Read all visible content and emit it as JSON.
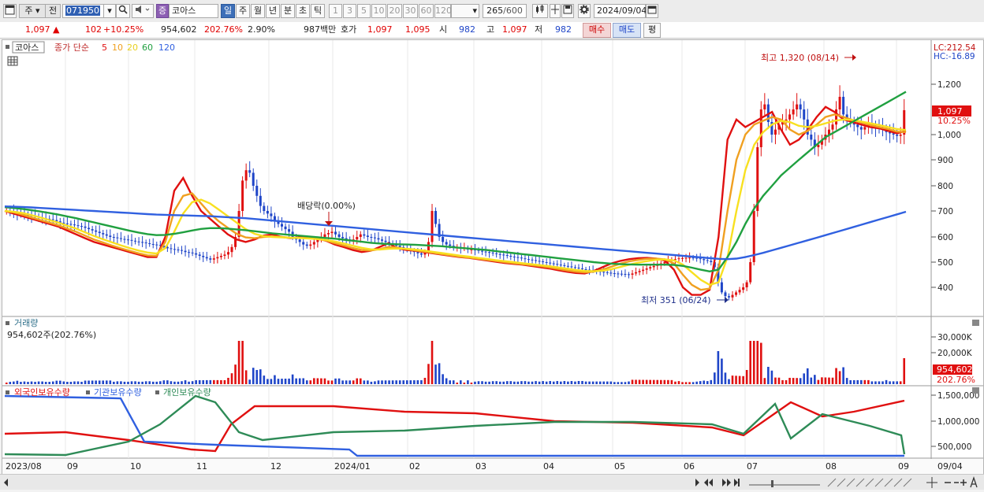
{
  "toolbar": {
    "period_type": "주",
    "prev_label": "전",
    "code": "071950",
    "badge": "증",
    "stock_name": "코아스",
    "timeframes": [
      "일",
      "주",
      "월",
      "년",
      "분",
      "초",
      "틱"
    ],
    "active_timeframe": "일",
    "intervals": [
      "1",
      "3",
      "5",
      "10",
      "20",
      "30",
      "60",
      "120"
    ],
    "count_display": "265",
    "count_total": "/600",
    "date": "2024/09/04"
  },
  "quote": {
    "price": "1,097",
    "arrow": "▲",
    "change": "102",
    "change_pct": "+10.25%",
    "volume": "954,602",
    "volume_ratio": "202.76%",
    "turnover": "2.90%",
    "amount": "987백만",
    "bid_label": "호가",
    "bid1": "1,097",
    "bid2": "1,095",
    "open_label": "시",
    "open": "982",
    "high_label": "고",
    "high": "1,097",
    "low_label": "저",
    "low": "982",
    "buy_label": "매수",
    "sell_label": "매도",
    "eval_label": "평"
  },
  "chart_data": [
    {
      "type": "candlestick",
      "title": "코아스",
      "legend_prefix": "종가 단순",
      "ma_periods": [
        "5",
        "10",
        "20",
        "60",
        "120"
      ],
      "ma_colors": [
        "#e01010",
        "#f0a020",
        "#f8e020",
        "#20a040",
        "#3060e0"
      ],
      "yticks": [
        400,
        500,
        600,
        700,
        800,
        900,
        1000,
        1200
      ],
      "ytick_labels": [
        "400",
        "500",
        "600",
        "700",
        "800",
        "900",
        "1,000",
        "1,200"
      ],
      "ylim": [
        310,
        1410
      ],
      "x_labels": [
        "2023/08",
        "09",
        "10",
        "11",
        "12",
        "2024/01",
        "02",
        "03",
        "04",
        "05",
        "06",
        "07",
        "08",
        "09",
        "09/04"
      ],
      "last_price_label": "1,097",
      "last_change_label": "10.25%",
      "lc_label": "LC:212.54",
      "hc_label": "HC:-16.89",
      "annotations": {
        "high": "최고 1,320 (08/14)",
        "low": "최저 351 (06/24)",
        "dividend": "배당락(0.00%)"
      },
      "close_series": [
        700,
        698,
        695,
        690,
        688,
        685,
        683,
        680,
        678,
        675,
        672,
        670,
        668,
        665,
        660,
        655,
        652,
        650,
        648,
        645,
        642,
        640,
        635,
        630,
        625,
        620,
        615,
        610,
        605,
        600,
        598,
        595,
        592,
        590,
        588,
        585,
        582,
        580,
        578,
        575,
        572,
        570,
        568,
        565,
        560,
        555,
        552,
        550,
        548,
        545,
        540,
        538,
        535,
        530,
        525,
        520,
        515,
        510,
        515,
        520,
        525,
        530,
        540,
        560,
        600,
        700,
        820,
        860,
        850,
        800,
        760,
        720,
        700,
        690,
        680,
        660,
        650,
        640,
        630,
        620,
        600,
        590,
        580,
        570,
        565,
        570,
        580,
        590,
        600,
        610,
        615,
        620,
        610,
        600,
        595,
        590,
        585,
        590,
        600,
        610,
        605,
        600,
        598,
        595,
        590,
        585,
        580,
        575,
        570,
        565,
        560,
        555,
        550,
        545,
        540,
        535,
        530,
        540,
        580,
        700,
        650,
        600,
        580,
        570,
        565,
        560,
        560,
        555,
        555,
        550,
        550,
        548,
        545,
        542,
        540,
        538,
        535,
        532,
        530,
        528,
        525,
        522,
        520,
        518,
        515,
        512,
        510,
        508,
        505,
        503,
        500,
        498,
        495,
        493,
        490,
        488,
        485,
        483,
        480,
        478,
        475,
        472,
        470,
        468,
        466,
        464,
        462,
        460,
        458,
        456,
        455,
        454,
        453,
        452,
        450,
        455,
        460,
        465,
        470,
        475,
        480,
        485,
        490,
        495,
        500,
        505,
        510,
        512,
        515,
        516,
        517,
        518,
        517,
        515,
        512,
        508,
        505,
        500,
        480,
        420,
        380,
        365,
        360,
        370,
        380,
        390,
        400,
        420,
        500,
        700,
        950,
        1100,
        1120,
        1050,
        1000,
        1020,
        1040,
        1050,
        1060,
        1080,
        1100,
        1120,
        1100,
        1060,
        1000,
        980,
        950,
        960,
        980,
        1000,
        1020,
        1040,
        1100,
        1150,
        1080,
        1060,
        1050,
        1040,
        1030,
        1020,
        1030,
        1040,
        1035,
        1030,
        1025,
        1020,
        1010,
        1005,
        1000,
        995,
        1000,
        1097
      ],
      "ma_series": {
        "5": [
          700,
          690,
          680,
          670,
          660,
          650,
          640,
          625,
          610,
          595,
          580,
          570,
          560,
          550,
          540,
          530,
          520,
          520,
          600,
          780,
          830,
          760,
          700,
          670,
          640,
          610,
          590,
          580,
          590,
          605,
          610,
          600,
          595,
          598,
          600,
          595,
          585,
          570,
          560,
          548,
          540,
          545,
          560,
          575,
          555,
          548,
          545,
          540,
          535,
          530,
          525,
          520,
          517,
          512,
          507,
          502,
          497,
          493,
          490,
          485,
          480,
          475,
          468,
          462,
          457,
          455,
          465,
          480,
          495,
          505,
          512,
          516,
          517,
          514,
          506,
          470,
          400,
          370,
          370,
          390,
          600,
          980,
          1060,
          1030,
          1050,
          1070,
          1090,
          1020,
          960,
          980,
          1020,
          1070,
          1110,
          1090,
          1060,
          1050,
          1040,
          1030,
          1025,
          1015,
          1005,
          1015
        ],
        "10": [
          700,
          695,
          685,
          675,
          665,
          655,
          645,
          632,
          620,
          605,
          590,
          578,
          566,
          555,
          545,
          535,
          527,
          525,
          580,
          700,
          760,
          770,
          730,
          690,
          660,
          635,
          612,
          598,
          595,
          600,
          602,
          600,
          597,
          596,
          595,
          592,
          586,
          575,
          566,
          556,
          548,
          546,
          552,
          560,
          558,
          552,
          547,
          542,
          537,
          532,
          527,
          522,
          518,
          514,
          509,
          505,
          500,
          496,
          492,
          488,
          484,
          479,
          473,
          467,
          462,
          459,
          462,
          470,
          482,
          494,
          503,
          509,
          513,
          514,
          511,
          495,
          450,
          410,
          390,
          395,
          470,
          700,
          900,
          1000,
          1040,
          1055,
          1070,
          1060,
          1020,
          1000,
          1015,
          1040,
          1070,
          1080,
          1070,
          1058,
          1048,
          1038,
          1030,
          1022,
          1012,
          1010
        ],
        "20": [
          700,
          697,
          692,
          684,
          675,
          665,
          655,
          643,
          632,
          618,
          604,
          591,
          579,
          567,
          556,
          546,
          538,
          534,
          556,
          620,
          690,
          735,
          745,
          730,
          705,
          680,
          655,
          630,
          612,
          603,
          600,
          598,
          597,
          596,
          594,
          592,
          588,
          582,
          574,
          565,
          557,
          551,
          550,
          553,
          554,
          553,
          550,
          546,
          541,
          536,
          531,
          526,
          522,
          517,
          513,
          508,
          504,
          500,
          496,
          492,
          488,
          484,
          479,
          474,
          469,
          465,
          464,
          466,
          472,
          481,
          490,
          498,
          504,
          509,
          511,
          507,
          490,
          460,
          430,
          410,
          420,
          520,
          700,
          860,
          960,
          1010,
          1040,
          1055,
          1050,
          1035,
          1030,
          1035,
          1045,
          1055,
          1060,
          1058,
          1052,
          1045,
          1038,
          1030,
          1022,
          1018
        ],
        "60": [
          715,
          712,
          708,
          703,
          698,
          692,
          686,
          679,
          672,
          664,
          656,
          648,
          640,
          632,
          624,
          617,
          611,
          607,
          608,
          612,
          618,
          625,
          631,
          634,
          634,
          632,
          629,
          626,
          622,
          618,
          614,
          611,
          608,
          605,
          602,
          599,
          596,
          593,
          589,
          585,
          581,
          577,
          574,
          572,
          571,
          570,
          569,
          567,
          565,
          563,
          560,
          557,
          554,
          551,
          548,
          544,
          540,
          536,
          532,
          528,
          524,
          520,
          516,
          512,
          508,
          504,
          500,
          497,
          494,
          492,
          491,
          490,
          490,
          490,
          490,
          489,
          485,
          478,
          470,
          463,
          470,
          520,
          580,
          650,
          710,
          760,
          800,
          840,
          870,
          900,
          930,
          960,
          990,
          1010,
          1030,
          1050,
          1070,
          1090,
          1110,
          1130,
          1150,
          1170
        ],
        "120": [
          718,
          717,
          716,
          714,
          712,
          710,
          708,
          706,
          704,
          702,
          700,
          698,
          696,
          694,
          692,
          690,
          688,
          686,
          685,
          684,
          683,
          682,
          681,
          680,
          678,
          676,
          674,
          672,
          669,
          666,
          663,
          660,
          657,
          654,
          651,
          648,
          645,
          642,
          639,
          636,
          633,
          630,
          627,
          624,
          621,
          618,
          615,
          612,
          609,
          606,
          603,
          600,
          597,
          594,
          591,
          588,
          585,
          582,
          579,
          576,
          573,
          570,
          567,
          564,
          561,
          558,
          555,
          552,
          549,
          546,
          543,
          540,
          537,
          534,
          531,
          528,
          525,
          522,
          519,
          516,
          513,
          512,
          514,
          520,
          528,
          537,
          547,
          557,
          567,
          577,
          587,
          597,
          607,
          617,
          627,
          637,
          647,
          657,
          667,
          677,
          687,
          697
        ]
      }
    },
    {
      "type": "bar",
      "title": "거래량",
      "value_label": "954,602주(202.76%)",
      "yticks": [
        20000,
        30000
      ],
      "ytick_labels": [
        "20,000K",
        "30,000K"
      ],
      "last_value_label": "954,602",
      "last_pct_label": "202.76%",
      "unit": "K"
    },
    {
      "type": "line",
      "series": [
        {
          "name": "외국인보유수량",
          "color": "#e01010"
        },
        {
          "name": "기관보유수량",
          "color": "#3060e0"
        },
        {
          "name": "개인보유수량",
          "color": "#2e8b57"
        }
      ],
      "yticks": [
        500000,
        1000000,
        1500000
      ],
      "ytick_labels": [
        "500,000",
        "1,000,000",
        "1,500,000"
      ]
    }
  ]
}
